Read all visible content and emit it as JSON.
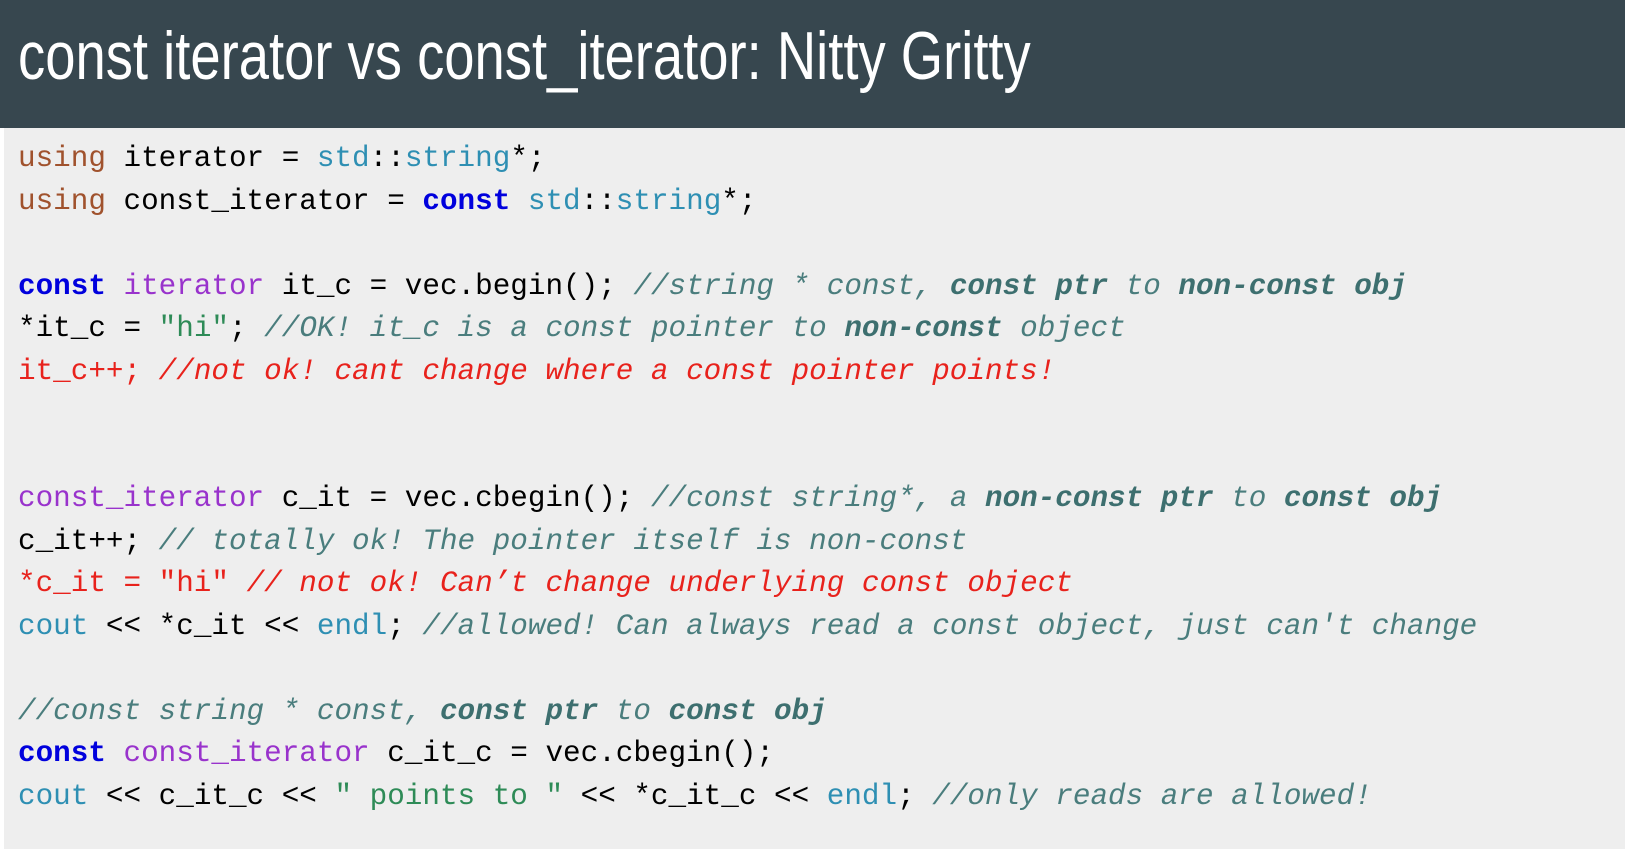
{
  "title": "const iterator vs const_iterator: Nitty Gritty",
  "code_lines": [
    {
      "tokens": [
        {
          "t": "using",
          "c": "kw-using"
        },
        {
          "t": " iterator = ",
          "c": "plain"
        },
        {
          "t": "std",
          "c": "type"
        },
        {
          "t": "::",
          "c": "plain"
        },
        {
          "t": "string",
          "c": "type"
        },
        {
          "t": "*;",
          "c": "plain"
        }
      ]
    },
    {
      "tokens": [
        {
          "t": "using",
          "c": "kw-using"
        },
        {
          "t": " const_iterator = ",
          "c": "plain"
        },
        {
          "t": "const",
          "c": "kw-const"
        },
        {
          "t": " ",
          "c": "plain"
        },
        {
          "t": "std",
          "c": "type"
        },
        {
          "t": "::",
          "c": "plain"
        },
        {
          "t": "string",
          "c": "type"
        },
        {
          "t": "*;",
          "c": "plain"
        }
      ]
    },
    {
      "tokens": []
    },
    {
      "tokens": [
        {
          "t": "const",
          "c": "kw-const"
        },
        {
          "t": " ",
          "c": "plain"
        },
        {
          "t": "iterator",
          "c": "ident"
        },
        {
          "t": " it_c = vec.begin(); ",
          "c": "plain"
        },
        {
          "t": "//string * const, ",
          "c": "cmt"
        },
        {
          "t": "const ptr",
          "c": "cmt-b"
        },
        {
          "t": " to ",
          "c": "cmt"
        },
        {
          "t": "non-const obj",
          "c": "cmt-b"
        }
      ]
    },
    {
      "tokens": [
        {
          "t": "*it_c = ",
          "c": "plain"
        },
        {
          "t": "\"hi\"",
          "c": "str"
        },
        {
          "t": "; ",
          "c": "plain"
        },
        {
          "t": "//OK! it_c is a const pointer to ",
          "c": "cmt"
        },
        {
          "t": "non-const",
          "c": "cmt-b"
        },
        {
          "t": " object",
          "c": "cmt"
        }
      ]
    },
    {
      "tokens": [
        {
          "t": "it_c++; ",
          "c": "err"
        },
        {
          "t": "//not ok! cant change where a const pointer points!",
          "c": "err-i"
        }
      ]
    },
    {
      "tokens": []
    },
    {
      "tokens": []
    },
    {
      "tokens": [
        {
          "t": "const_iterator",
          "c": "ident"
        },
        {
          "t": " c_it = vec.cbegin(); ",
          "c": "plain"
        },
        {
          "t": "//const string*, a ",
          "c": "cmt"
        },
        {
          "t": "non-const ptr",
          "c": "cmt-b"
        },
        {
          "t": " to ",
          "c": "cmt"
        },
        {
          "t": "const obj",
          "c": "cmt-b"
        }
      ]
    },
    {
      "tokens": [
        {
          "t": "c_it++; ",
          "c": "plain"
        },
        {
          "t": "// totally ok! The pointer itself is non-const",
          "c": "cmt"
        }
      ]
    },
    {
      "tokens": [
        {
          "t": "*c_it = \"hi\" ",
          "c": "err"
        },
        {
          "t": "// not ok! Can’t change underlying const object",
          "c": "err-i"
        }
      ]
    },
    {
      "tokens": [
        {
          "t": "cout",
          "c": "type"
        },
        {
          "t": " << *c_it << ",
          "c": "plain"
        },
        {
          "t": "endl",
          "c": "type"
        },
        {
          "t": "; ",
          "c": "plain"
        },
        {
          "t": "//allowed! Can always read a const object, just can't change",
          "c": "cmt"
        }
      ]
    },
    {
      "tokens": []
    },
    {
      "tokens": [
        {
          "t": "//const string * const, ",
          "c": "cmt"
        },
        {
          "t": "const ptr",
          "c": "cmt-b"
        },
        {
          "t": " to ",
          "c": "cmt"
        },
        {
          "t": "const obj",
          "c": "cmt-b"
        }
      ]
    },
    {
      "tokens": [
        {
          "t": "const",
          "c": "kw-const"
        },
        {
          "t": " ",
          "c": "plain"
        },
        {
          "t": "const_iterator",
          "c": "ident"
        },
        {
          "t": " c_it_c = vec.cbegin();",
          "c": "plain"
        }
      ]
    },
    {
      "tokens": [
        {
          "t": "cout",
          "c": "type"
        },
        {
          "t": " << c_it_c << ",
          "c": "plain"
        },
        {
          "t": "\" points to \"",
          "c": "str"
        },
        {
          "t": " << *c_it_c << ",
          "c": "plain"
        },
        {
          "t": "endl",
          "c": "type"
        },
        {
          "t": "; ",
          "c": "plain"
        },
        {
          "t": "//only reads are allowed!",
          "c": "cmt"
        }
      ]
    }
  ]
}
